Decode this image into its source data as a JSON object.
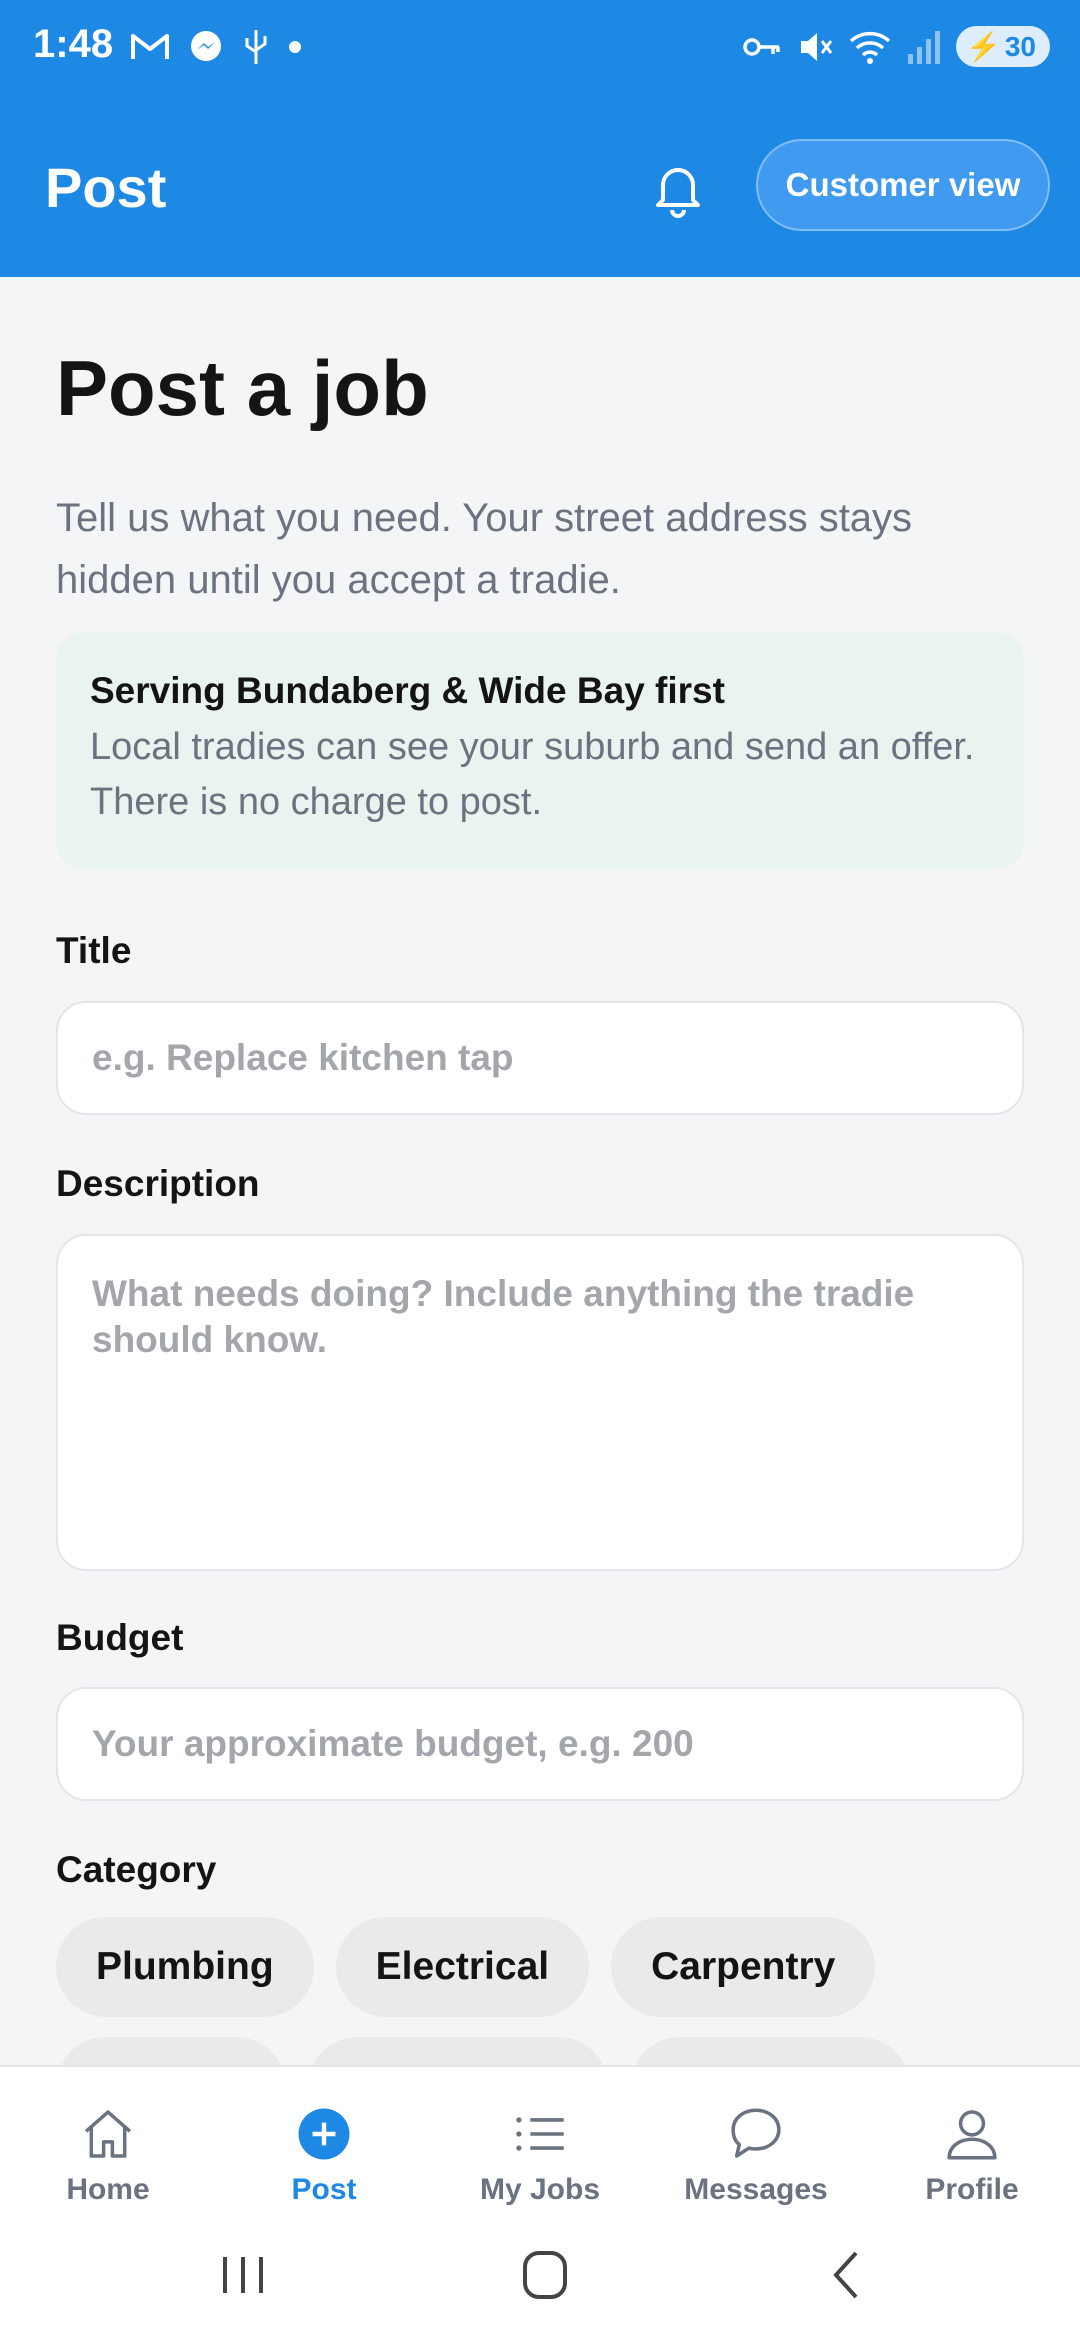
{
  "status_bar": {
    "time": "1:48",
    "battery": "30",
    "left_icons": [
      "gmail-icon",
      "messenger-icon",
      "usb-icon",
      "dot-icon"
    ],
    "right_icons": [
      "key-icon",
      "mute-icon",
      "wifi-icon",
      "signal-icon"
    ]
  },
  "header": {
    "title": "Post",
    "customer_view_label": "Customer view",
    "accent": "#1e88e5"
  },
  "page": {
    "title": "Post a job",
    "subtitle": "Tell us what you need. Your street address stays hidden until you accept a tradie."
  },
  "info_card": {
    "title": "Serving Bundaberg & Wide Bay first",
    "description": "Local tradies can see your suburb and send an offer. There is no charge to post."
  },
  "form": {
    "title_label": "Title",
    "title_placeholder": "e.g. Replace kitchen tap",
    "description_label": "Description",
    "description_placeholder": "What needs doing? Include anything the tradie should know.",
    "budget_label": "Budget",
    "budget_placeholder": "Your approximate budget, e.g. 200",
    "category_label": "Category",
    "categories": [
      "Plumbing",
      "Electrical",
      "Carpentry"
    ]
  },
  "bottom_nav": {
    "items": [
      {
        "label": "Home",
        "icon": "home-icon"
      },
      {
        "label": "Post",
        "icon": "plus-circle-icon"
      },
      {
        "label": "My Jobs",
        "icon": "list-icon"
      },
      {
        "label": "Messages",
        "icon": "chat-icon"
      },
      {
        "label": "Profile",
        "icon": "person-icon"
      }
    ],
    "active": "Post"
  }
}
